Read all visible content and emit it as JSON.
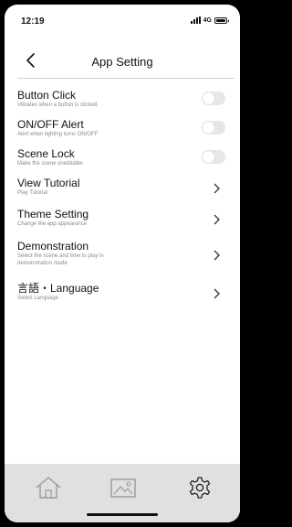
{
  "status_bar": {
    "time": "12:19",
    "network": "4G"
  },
  "header": {
    "title": "App Setting"
  },
  "settings": [
    {
      "label": "Button Click",
      "description": "Vibrates when a button is clicked.",
      "control": "toggle",
      "on": false
    },
    {
      "label": "ON/OFF Alert",
      "description": "Alert when lighting turns ON/OFF",
      "control": "toggle",
      "on": false
    },
    {
      "label": "Scene Lock",
      "description": "Make the scene uneditable",
      "control": "toggle",
      "on": false
    },
    {
      "label": "View Tutorial",
      "description": "Play Tutorial",
      "control": "chevron"
    },
    {
      "label": "Theme Setting",
      "description": "Change the app appearance",
      "control": "chevron"
    },
    {
      "label": "Demonstration",
      "description": "Select the scene and time to play in demonstration mode",
      "control": "chevron"
    },
    {
      "label": "言語・Language",
      "description": "Select Language",
      "control": "chevron"
    }
  ],
  "bottom_nav": {
    "items": [
      "home-icon",
      "gallery-icon",
      "settings-gear-icon"
    ],
    "active": "settings-gear-icon"
  },
  "colors": {
    "toggle_off": "#e6e6e6",
    "nav_bg": "#e0e0e0",
    "description_text": "#8a8a8a"
  }
}
